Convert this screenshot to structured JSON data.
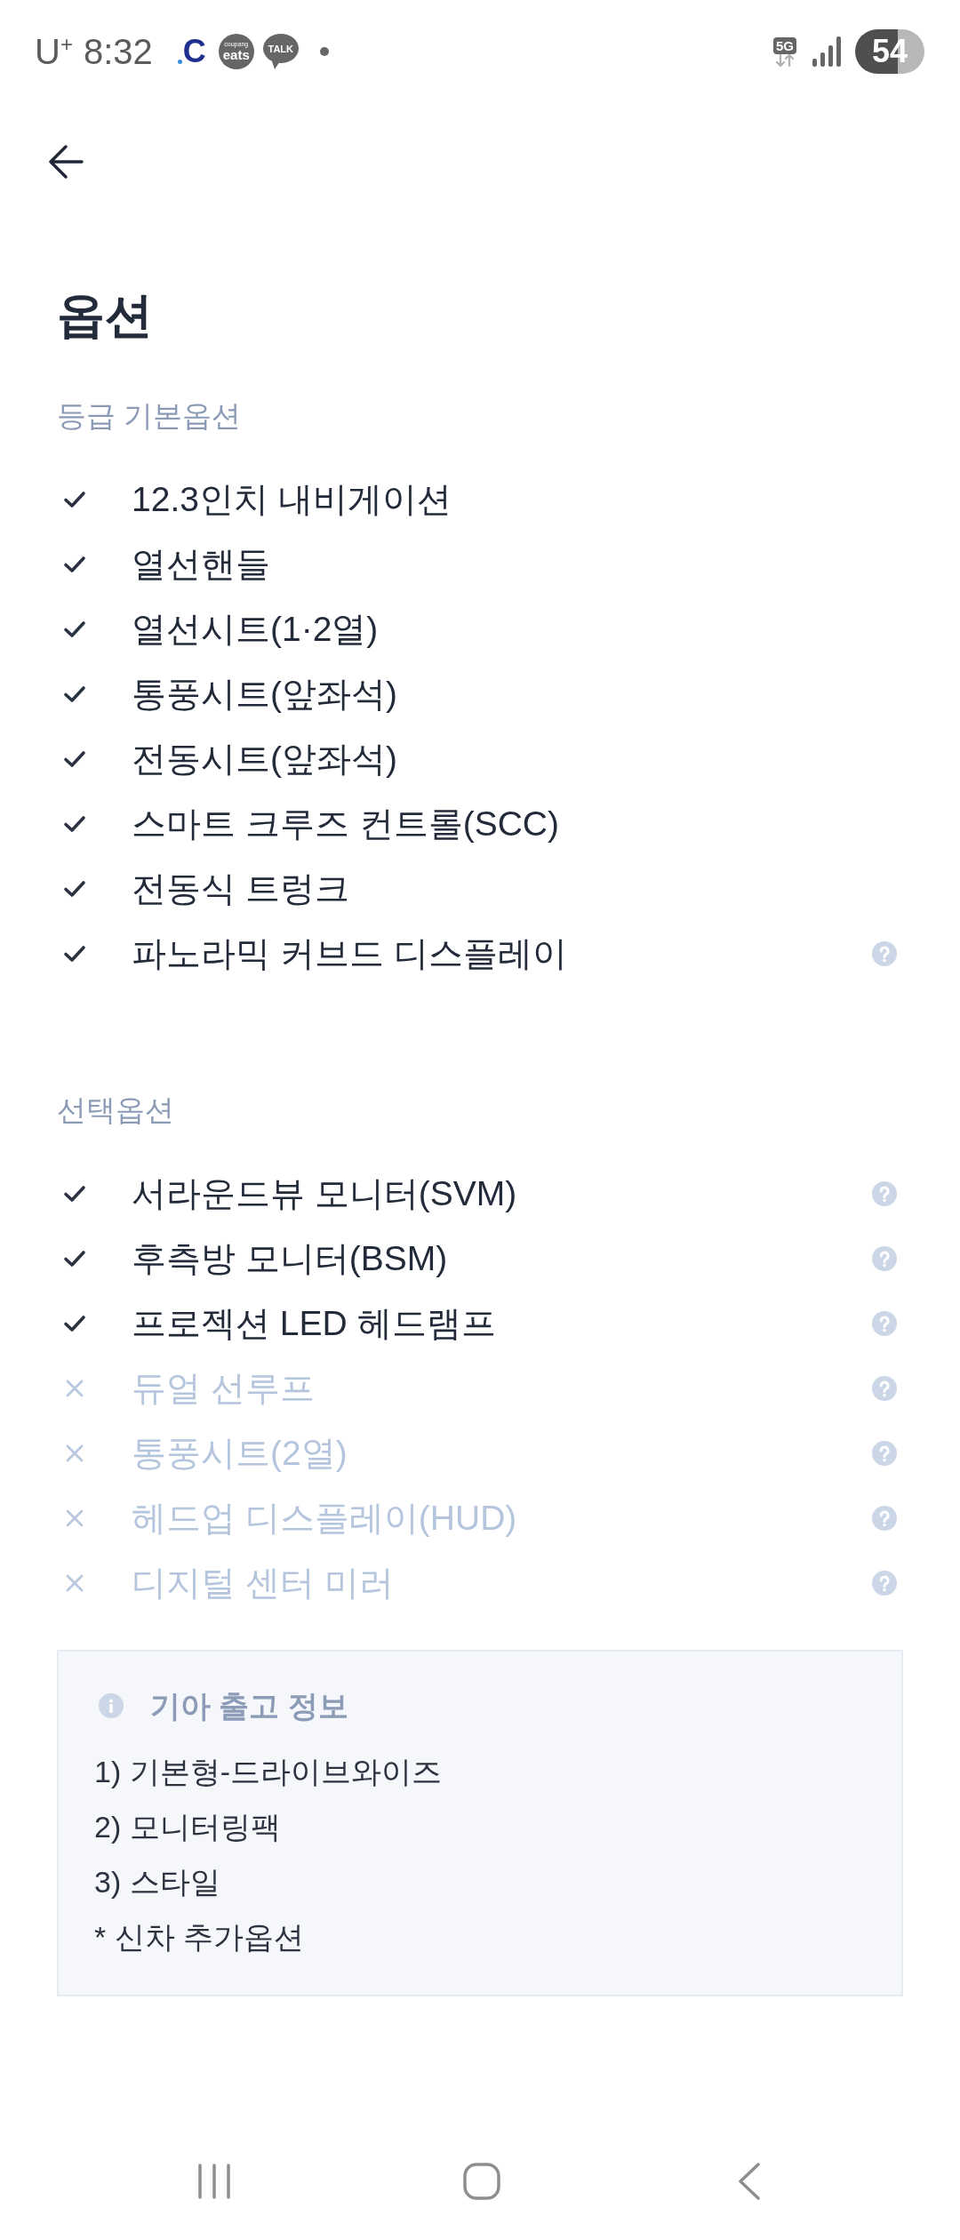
{
  "status_bar": {
    "carrier": "U$^{+}$",
    "time": "8:32",
    "notifications": [
      {
        "kind": "letter",
        "label": "C"
      },
      {
        "kind": "badge",
        "caption": "coupang",
        "label": "eats"
      },
      {
        "kind": "bubble",
        "label": "TALK"
      },
      {
        "kind": "dot"
      }
    ],
    "network": "5G",
    "battery": "54"
  },
  "title": "옵션",
  "sections": [
    {
      "heading": "등급 기본옵션",
      "items": [
        {
          "label": "12.3인치 내비게이션",
          "included": true,
          "help": false
        },
        {
          "label": "열선핸들",
          "included": true,
          "help": false
        },
        {
          "label": "열선시트(1·2열)",
          "included": true,
          "help": false
        },
        {
          "label": "통풍시트(앞좌석)",
          "included": true,
          "help": false
        },
        {
          "label": "전동시트(앞좌석)",
          "included": true,
          "help": false
        },
        {
          "label": "스마트 크루즈 컨트롤(SCC)",
          "included": true,
          "help": false
        },
        {
          "label": "전동식 트렁크",
          "included": true,
          "help": false
        },
        {
          "label": "파노라믹 커브드 디스플레이",
          "included": true,
          "help": true
        }
      ]
    },
    {
      "heading": "선택옵션",
      "items": [
        {
          "label": "서라운드뷰 모니터(SVM)",
          "included": true,
          "help": true
        },
        {
          "label": "후측방 모니터(BSM)",
          "included": true,
          "help": true
        },
        {
          "label": "프로젝션 LED 헤드램프",
          "included": true,
          "help": true
        },
        {
          "label": "듀얼 선루프",
          "included": false,
          "help": true
        },
        {
          "label": "통풍시트(2열)",
          "included": false,
          "help": true
        },
        {
          "label": "헤드업 디스플레이(HUD)",
          "included": false,
          "help": true
        },
        {
          "label": "디지털 센터 미러",
          "included": false,
          "help": true
        }
      ]
    }
  ],
  "info_box": {
    "title": "기아 출고 정보",
    "lines": [
      "1) 기본형-드라이브와이즈",
      "2) 모니터링팩",
      "3) 스타일",
      "* 신차 추가옵션"
    ]
  },
  "nav_bar": [
    {
      "kind": "recents"
    },
    {
      "kind": "home"
    },
    {
      "kind": "back"
    }
  ]
}
